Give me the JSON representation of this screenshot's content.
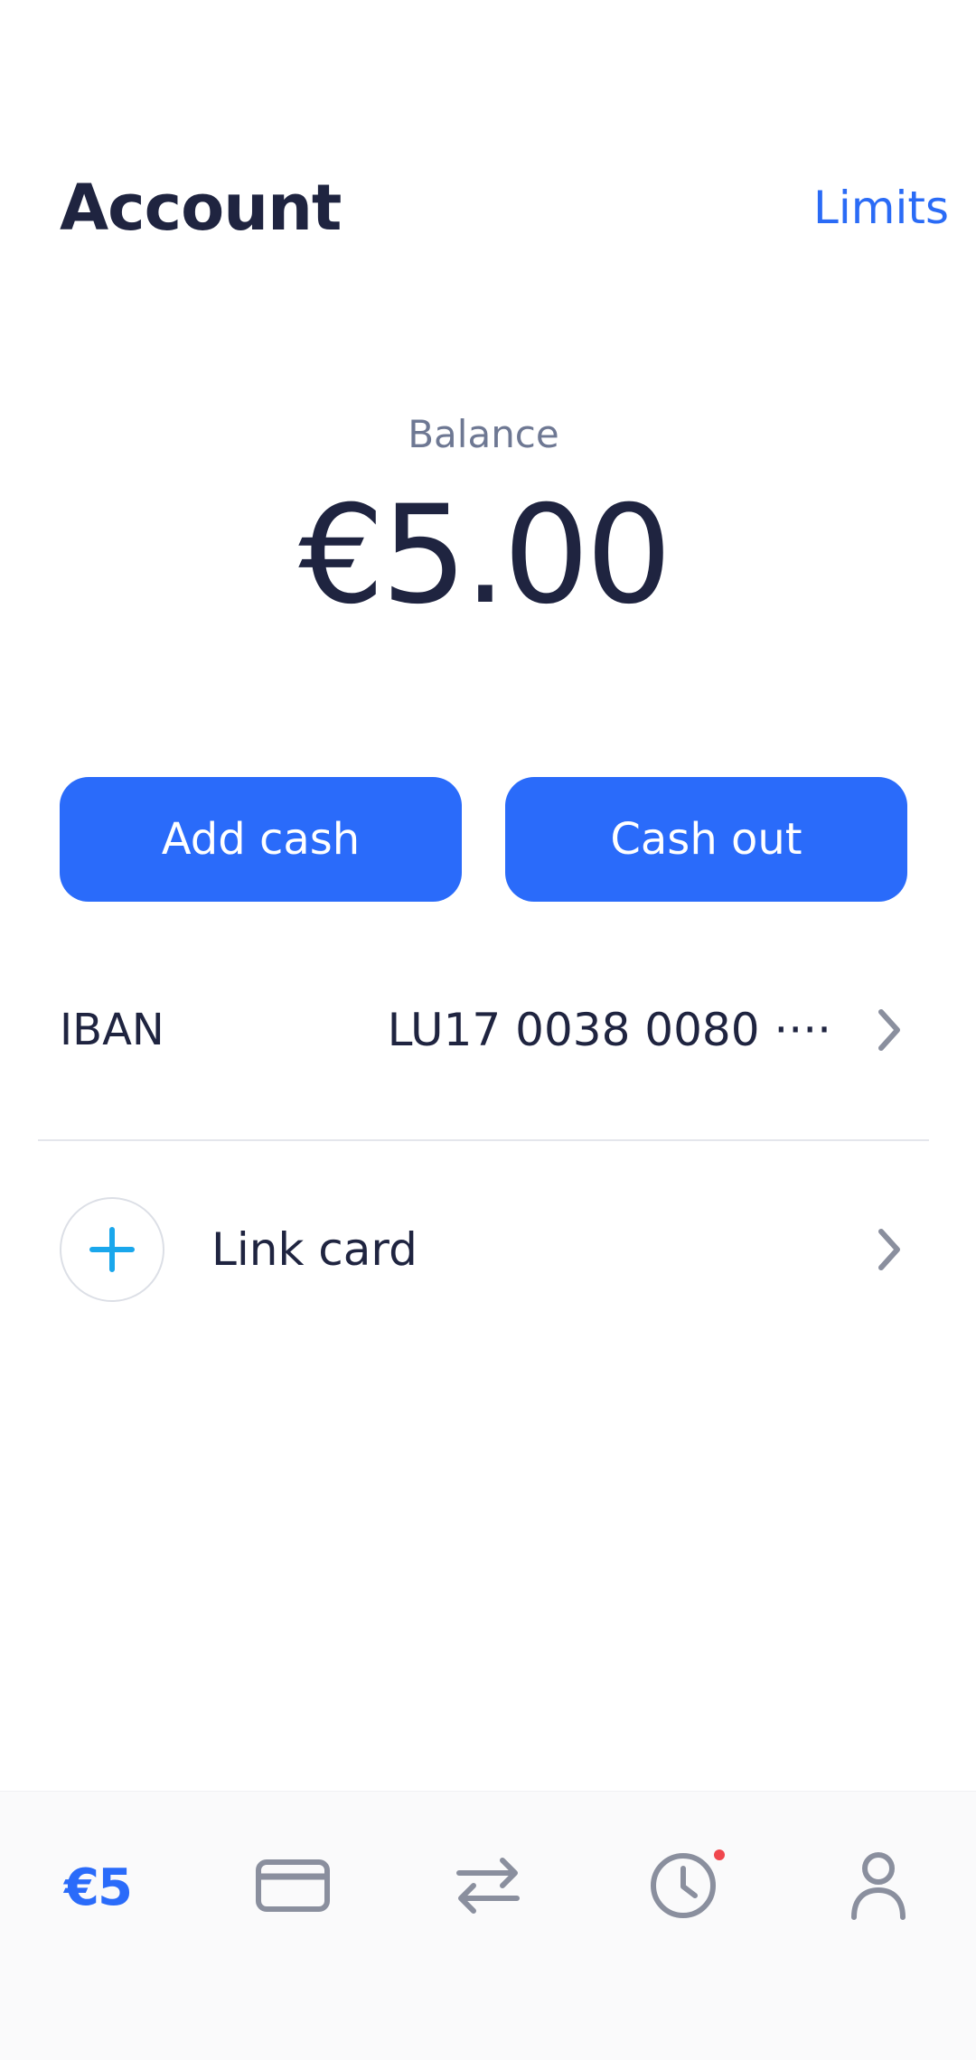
{
  "header": {
    "title": "Account",
    "limits_label": "Limits"
  },
  "balance": {
    "label": "Balance",
    "amount": "€5.00"
  },
  "actions": {
    "add_cash_label": "Add cash",
    "cash_out_label": "Cash out"
  },
  "iban": {
    "label": "IBAN",
    "value": "LU17 0038 0080 ····"
  },
  "link_card": {
    "label": "Link card"
  },
  "bottom_nav": {
    "balance_label": "€5",
    "items": [
      "balance",
      "card-icon",
      "transfer-icon",
      "history-icon",
      "profile-icon"
    ],
    "history_has_notification": true
  },
  "colors": {
    "accent": "#2a6bfa",
    "text_primary": "#1f2440",
    "text_secondary": "#6e7893",
    "icon_inactive": "#8a8f9e",
    "plus_icon": "#1aa7ec",
    "notification": "#f0474e"
  }
}
